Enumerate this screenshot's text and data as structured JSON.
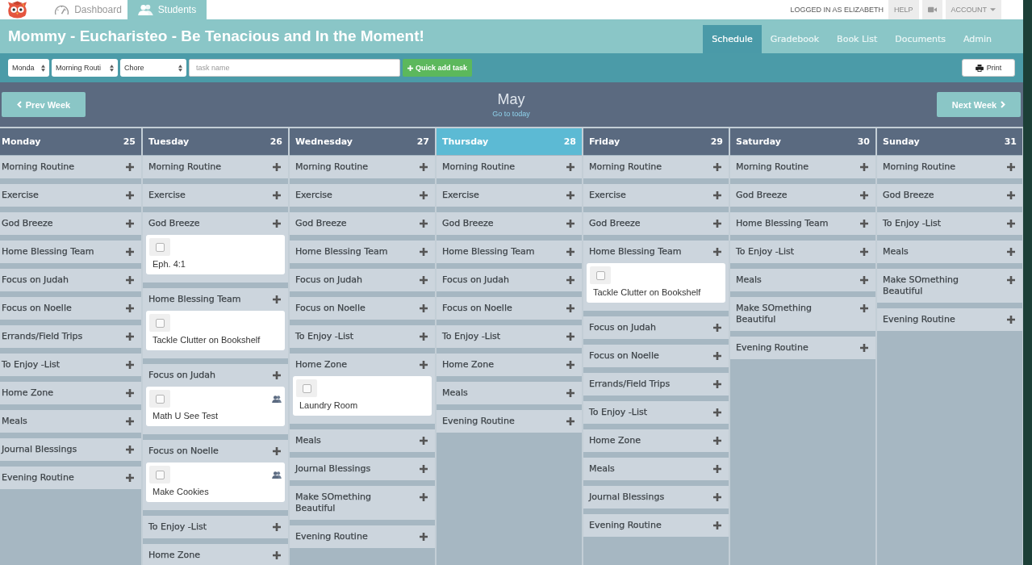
{
  "top_bar": {
    "tabs": [
      {
        "label": "Dashboard",
        "kind": "gauge",
        "selected": false
      },
      {
        "label": "Students",
        "kind": "people",
        "selected": true
      }
    ],
    "user": "LOGGED IN AS ELIZABETH",
    "help": "HELP",
    "account": "ACCOUNT"
  },
  "title": "Mommy - Eucharisteo - Be Tenacious and In the Moment!",
  "nav_tabs": [
    {
      "label": "Schedule",
      "selected": true
    },
    {
      "label": "Gradebook",
      "selected": false
    },
    {
      "label": "Book List",
      "selected": false
    },
    {
      "label": "Documents",
      "selected": false
    },
    {
      "label": "Admin",
      "selected": false
    }
  ],
  "toolbar": {
    "day_select": "Monda",
    "category_select": "Morning Routi",
    "type_select": "Chore",
    "task_name": {
      "placeholder": "task name"
    },
    "quick_add": "Quick add task",
    "print": "Print"
  },
  "week_nav": {
    "prev": "Prev Week",
    "month": "May",
    "go_to_today": "Go to today",
    "next": "Next Week"
  },
  "days": [
    {
      "name": "Monday",
      "date": "25",
      "today": false,
      "categories": [
        {
          "name": "Morning Routine"
        },
        {
          "name": "Exercise"
        },
        {
          "name": "God Breeze"
        },
        {
          "name": "Home Blessing Team"
        },
        {
          "name": "Focus on Judah"
        },
        {
          "name": "Focus on Noelle"
        },
        {
          "name": "Errands/Field Trips"
        },
        {
          "name": "To Enjoy -List"
        },
        {
          "name": "Home Zone"
        },
        {
          "name": "Meals"
        },
        {
          "name": "Journal Blessings"
        },
        {
          "name": "Evening Routine"
        }
      ]
    },
    {
      "name": "Tuesday",
      "date": "26",
      "today": false,
      "categories": [
        {
          "name": "Morning Routine"
        },
        {
          "name": "Exercise"
        },
        {
          "name": "God Breeze",
          "tasks": [
            {
              "name": "Eph. 4:1",
              "checked": false,
              "group": false
            }
          ]
        },
        {
          "name": "Home Blessing Team",
          "tasks": [
            {
              "name": "Tackle Clutter on Bookshelf",
              "checked": false,
              "group": false
            }
          ]
        },
        {
          "name": "Focus on Judah",
          "tasks": [
            {
              "name": "Math U See Test",
              "checked": false,
              "group": true
            }
          ]
        },
        {
          "name": "Focus on Noelle",
          "tasks": [
            {
              "name": "Make Cookies",
              "checked": false,
              "group": true
            }
          ]
        },
        {
          "name": "To Enjoy -List"
        },
        {
          "name": "Home Zone"
        }
      ]
    },
    {
      "name": "Wednesday",
      "date": "27",
      "today": false,
      "categories": [
        {
          "name": "Morning Routine"
        },
        {
          "name": "Exercise"
        },
        {
          "name": "God Breeze"
        },
        {
          "name": "Home Blessing Team"
        },
        {
          "name": "Focus on Judah"
        },
        {
          "name": "Focus on Noelle"
        },
        {
          "name": "To Enjoy -List"
        },
        {
          "name": "Home Zone",
          "tasks": [
            {
              "name": "Laundry Room",
              "checked": false,
              "group": false
            }
          ]
        },
        {
          "name": "Meals"
        },
        {
          "name": "Journal Blessings"
        },
        {
          "name": "Make SOmething Beautiful"
        },
        {
          "name": "Evening Routine"
        }
      ]
    },
    {
      "name": "Thursday",
      "date": "28",
      "today": true,
      "categories": [
        {
          "name": "Morning Routine"
        },
        {
          "name": "Exercise"
        },
        {
          "name": "God Breeze"
        },
        {
          "name": "Home Blessing Team"
        },
        {
          "name": "Focus on Judah"
        },
        {
          "name": "Focus on Noelle"
        },
        {
          "name": "To Enjoy -List"
        },
        {
          "name": "Home Zone"
        },
        {
          "name": "Meals"
        },
        {
          "name": "Evening Routine"
        }
      ]
    },
    {
      "name": "Friday",
      "date": "29",
      "today": false,
      "categories": [
        {
          "name": "Morning Routine"
        },
        {
          "name": "Exercise"
        },
        {
          "name": "God Breeze"
        },
        {
          "name": "Home Blessing Team",
          "tasks": [
            {
              "name": "Tackle Clutter on Bookshelf",
              "checked": false,
              "group": false
            }
          ]
        },
        {
          "name": "Focus on Judah"
        },
        {
          "name": "Focus on Noelle"
        },
        {
          "name": "Errands/Field Trips"
        },
        {
          "name": "To Enjoy -List"
        },
        {
          "name": "Home Zone"
        },
        {
          "name": "Meals"
        },
        {
          "name": "Journal Blessings"
        },
        {
          "name": "Evening Routine"
        }
      ]
    },
    {
      "name": "Saturday",
      "date": "30",
      "today": false,
      "categories": [
        {
          "name": "Morning Routine"
        },
        {
          "name": "God Breeze"
        },
        {
          "name": "Home Blessing Team"
        },
        {
          "name": "To Enjoy -List"
        },
        {
          "name": "Meals"
        },
        {
          "name": "Make SOmething Beautiful"
        },
        {
          "name": "Evening Routine"
        }
      ]
    },
    {
      "name": "Sunday",
      "date": "31",
      "today": false,
      "categories": [
        {
          "name": "Morning Routine"
        },
        {
          "name": "God Breeze"
        },
        {
          "name": "To Enjoy -List"
        },
        {
          "name": "Meals"
        },
        {
          "name": "Make SOmething Beautiful"
        },
        {
          "name": "Evening Routine"
        }
      ]
    }
  ]
}
